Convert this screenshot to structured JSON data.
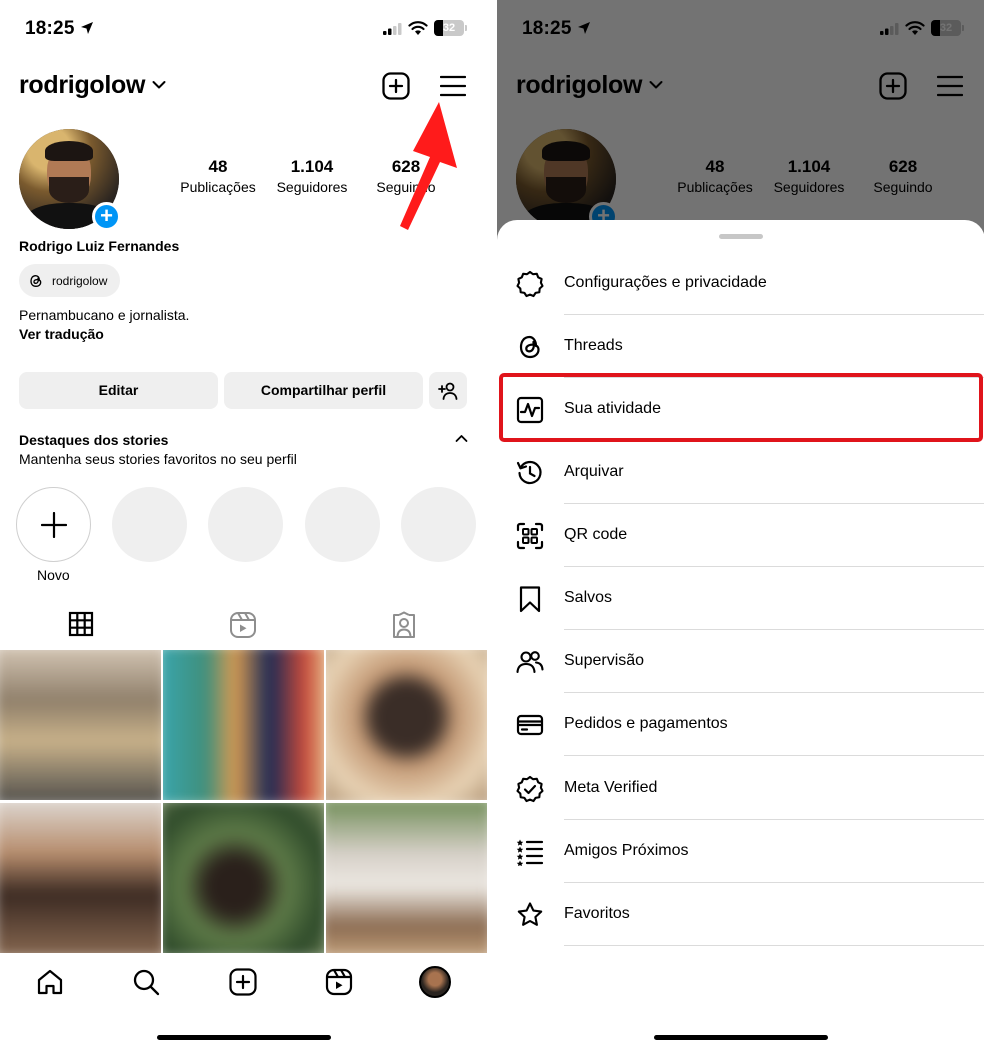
{
  "status_bar": {
    "time": "18:25",
    "battery": "32"
  },
  "profile": {
    "username": "rodrigolow",
    "stats": [
      {
        "value": "48",
        "label": "Publicações"
      },
      {
        "value": "1.104",
        "label": "Seguidores"
      },
      {
        "value": "628",
        "label": "Seguindo"
      }
    ],
    "full_name": "Rodrigo Luiz Fernandes",
    "threads_handle": "rodrigolow",
    "bio": "Pernambucano e jornalista.",
    "translate_link": "Ver tradução",
    "buttons": {
      "edit": "Editar",
      "share": "Compartilhar perfil"
    },
    "highlights": {
      "title": "Destaques dos stories",
      "subtitle": "Mantenha seus stories favoritos no seu perfil",
      "new_label": "Novo"
    }
  },
  "menu": {
    "items": [
      {
        "label": "Configurações e privacidade",
        "icon": "settings-icon"
      },
      {
        "label": "Threads",
        "icon": "threads-icon"
      },
      {
        "label": "Sua atividade",
        "icon": "activity-icon"
      },
      {
        "label": "Arquivar",
        "icon": "archive-icon"
      },
      {
        "label": "QR code",
        "icon": "qr-code-icon"
      },
      {
        "label": "Salvos",
        "icon": "bookmark-icon"
      },
      {
        "label": "Supervisão",
        "icon": "supervision-icon"
      },
      {
        "label": "Pedidos e pagamentos",
        "icon": "card-icon"
      },
      {
        "label": "Meta Verified",
        "icon": "verified-icon"
      },
      {
        "label": "Amigos Próximos",
        "icon": "close-friends-icon"
      },
      {
        "label": "Favoritos",
        "icon": "star-icon"
      }
    ],
    "highlighted_index": 2
  },
  "colors": {
    "accent_blue": "#0095f6",
    "highlight_red": "#e0141b",
    "arrow_red": "#ff1b1b"
  }
}
